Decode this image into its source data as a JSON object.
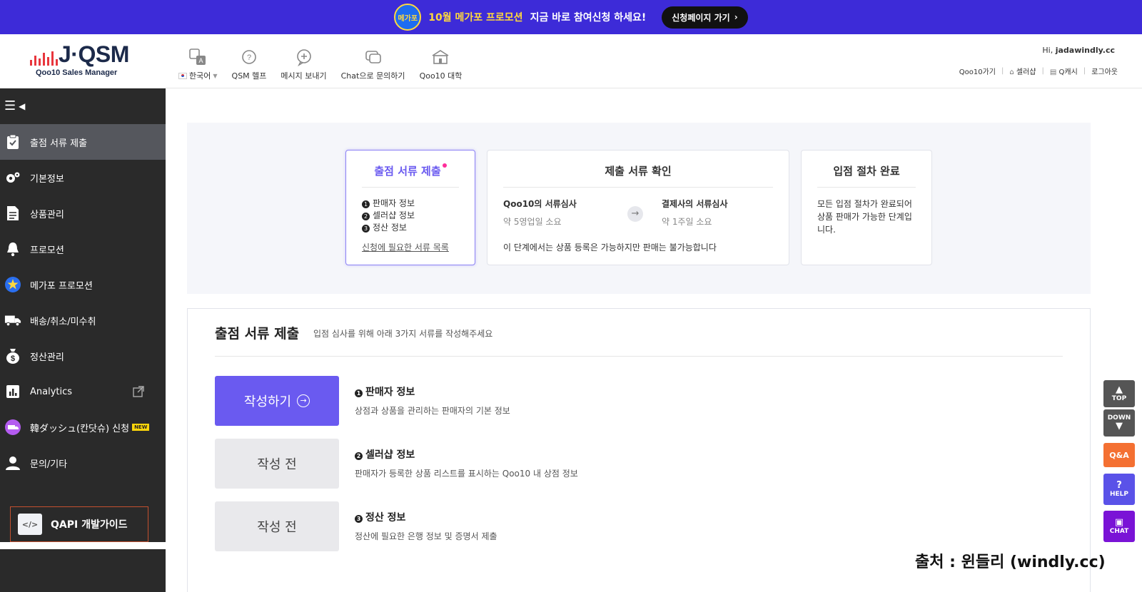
{
  "promo": {
    "badge": "메가포",
    "highlight": "10월 메가포 프로모션",
    "text": "지금 바로 참여신청 하세요!",
    "button": "신청페이지 가기"
  },
  "header": {
    "logo_title": "J·QSM",
    "logo_sub": "Qoo10 Sales Manager",
    "nav": [
      {
        "icon": "translate-icon",
        "label": "한국어"
      },
      {
        "icon": "help-icon",
        "label": "QSM 헬프"
      },
      {
        "icon": "message-icon",
        "label": "메시지 보내기"
      },
      {
        "icon": "chat-icon",
        "label": "Chat으로 문의하기"
      },
      {
        "icon": "school-icon",
        "label": "Qoo10 대학"
      }
    ],
    "user_prefix": "Hi, ",
    "user_name": "jadawindly.cc",
    "links": [
      "Qoo10가기",
      "셀러샵",
      "Q캐시",
      "로그아웃"
    ]
  },
  "sidebar": {
    "items": [
      {
        "icon": "clipboard-icon",
        "label": "출점 서류 제출"
      },
      {
        "icon": "gears-icon",
        "label": "기본정보"
      },
      {
        "icon": "document-icon",
        "label": "상품관리"
      },
      {
        "icon": "bell-icon",
        "label": "프로모션"
      },
      {
        "icon": "megapo-icon",
        "label": "메가포 프로모션"
      },
      {
        "icon": "truck-icon",
        "label": "배송/취소/미수취"
      },
      {
        "icon": "moneybag-icon",
        "label": "정산관리"
      },
      {
        "icon": "chart-icon",
        "label": "Analytics"
      },
      {
        "icon": "dash-icon",
        "label": "韓ダッシュ(칸닷슈) 신청",
        "badge": "NEW"
      },
      {
        "icon": "user-icon",
        "label": "문의/기타"
      }
    ],
    "qapi_label": "QAPI 개발가이드",
    "qapi_icon_text": "</>"
  },
  "steps": {
    "submit": {
      "title": "출점 서류 제출",
      "items": [
        "판매자 정보",
        "셀러샵 정보",
        "정산 정보"
      ],
      "link": "신청에 필요한 서류 목록"
    },
    "review": {
      "title": "제출 서류 확인",
      "col1_title": "Qoo10의 서류심사",
      "col1_sub": "약 5영업일 소요",
      "col2_title": "결제사의 서류심사",
      "col2_sub": "약 1주일 소요",
      "note": "이 단계에서는 상품 등록은 가능하지만 판매는 불가능합니다"
    },
    "complete": {
      "title": "입점 절차 완료",
      "text": "모든 입점 절차가 완료되어 상품 판매가 가능한 단계입니다."
    }
  },
  "form": {
    "title": "출점 서류 제출",
    "subtitle": "입점 심사를 위해 아래 3가지 서류를 작성해주세요",
    "rows": [
      {
        "button": "작성하기",
        "num": "1",
        "title": "판매자 정보",
        "desc": "상점과 상품을 관리하는 판매자의 기본 정보"
      },
      {
        "button": "작성 전",
        "num": "2",
        "title": "셀러샵 정보",
        "desc": "판매자가 등록한 상품 리스트를 표시하는 Qoo10 내 상점 정보"
      },
      {
        "button": "작성 전",
        "num": "3",
        "title": "정산 정보",
        "desc": "정산에 필요한 은행 정보 및 증명서 제출"
      }
    ]
  },
  "floating": {
    "top": "TOP",
    "down": "DOWN",
    "qa": "Q&A",
    "help": "HELP",
    "chat": "CHAT"
  },
  "source": "출처 : 윈들리 (windly.cc)",
  "colors": {
    "promo_bg": "#3d2bd8",
    "accent": "#6a5af0",
    "sidebar_bg": "#2a2a2a",
    "sidebar_active": "#55575d"
  }
}
